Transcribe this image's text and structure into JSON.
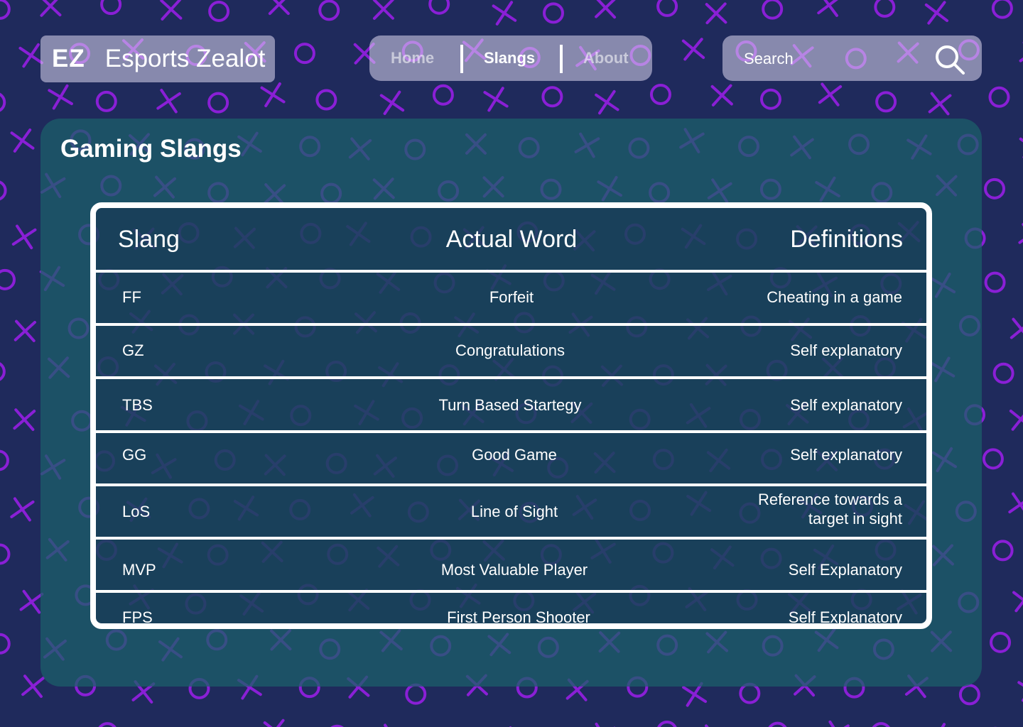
{
  "brand": {
    "mark": "EZ",
    "name": "Esports Zealot"
  },
  "nav": {
    "items": [
      {
        "label": "Home",
        "active": false
      },
      {
        "label": "Slangs",
        "active": true
      },
      {
        "label": "About",
        "active": false
      }
    ]
  },
  "search": {
    "placeholder": "Search",
    "value": ""
  },
  "page": {
    "title": "Gaming Slangs"
  },
  "table": {
    "headers": [
      "Slang",
      "Actual Word",
      "Definitions"
    ],
    "rows": [
      {
        "slang": "FF",
        "word": "Forfeit",
        "definition": [
          "Cheating in a game"
        ]
      },
      {
        "slang": "GZ",
        "word": "Congratulations",
        "definition": [
          "Self explanatory"
        ]
      },
      {
        "slang": "TBS",
        "word": "Turn Based Startegy",
        "definition": [
          "Self explanatory"
        ]
      },
      {
        "slang": "GG",
        "word": "Good Game",
        "definition": [
          "Self explanatory"
        ]
      },
      {
        "slang": "LoS",
        "word": "Line of Sight",
        "definition": [
          "Reference towards a",
          "target in sight"
        ]
      },
      {
        "slang": "MVP",
        "word": "Most Valuable Player",
        "definition": [
          "Self Explanatory"
        ]
      },
      {
        "slang": "FPS",
        "word": "First Person Shooter",
        "definition": [
          "Self Explanatory"
        ]
      }
    ]
  },
  "colors": {
    "background": "#1f2a5c",
    "pattern": "#8a1fd6",
    "panel": "#1c5f69",
    "glass": "#dcd7f0"
  }
}
